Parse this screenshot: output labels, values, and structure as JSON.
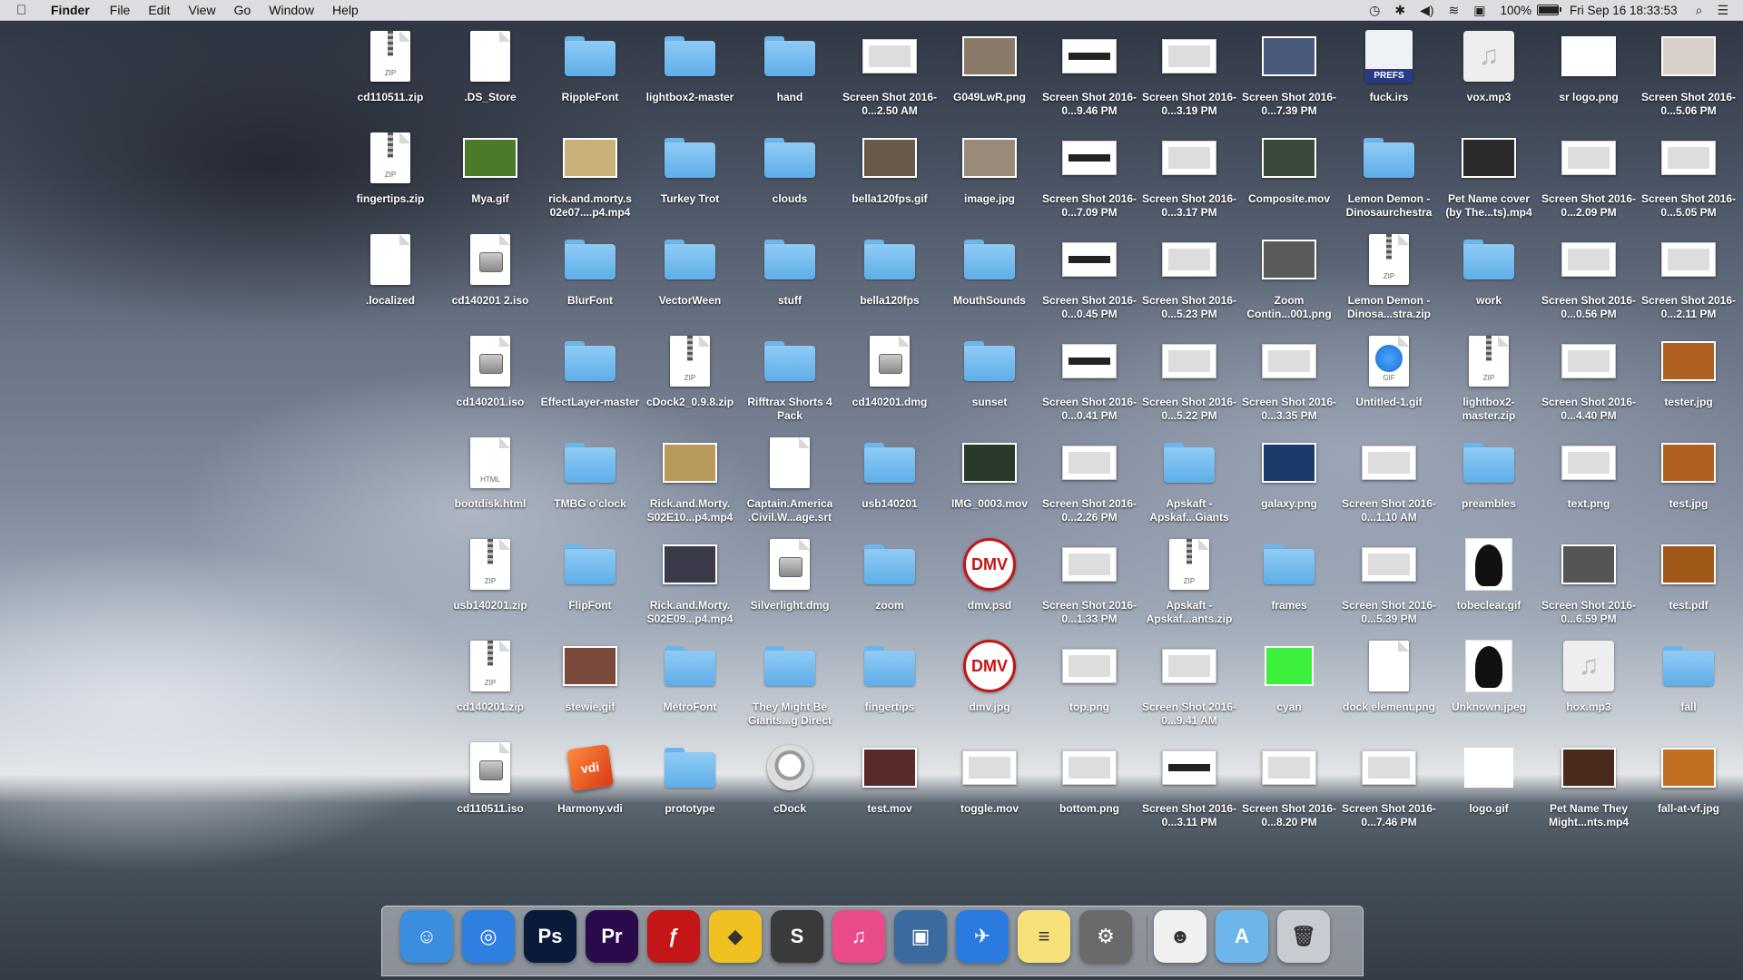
{
  "menubar": {
    "app": "Finder",
    "items": [
      "File",
      "Edit",
      "View",
      "Go",
      "Window",
      "Help"
    ],
    "battery_pct": "100%",
    "battery_level": 1.0,
    "clock": "Fri Sep 16  18:33:53"
  },
  "desktop": {
    "columns": [
      [
        {
          "label": "cd110511.zip",
          "kind": "zip",
          "tag": "ZIP"
        },
        {
          "label": "fingertips.zip",
          "kind": "zip",
          "tag": "ZIP"
        },
        {
          "label": ".localized",
          "kind": "doc",
          "tag": ""
        }
      ],
      [
        {
          "label": ".DS_Store",
          "kind": "doc",
          "tag": ""
        },
        {
          "label": "Mya.gif",
          "kind": "thumb",
          "color": "#4a7a2a"
        },
        {
          "label": "cd140201 2.iso",
          "kind": "disk",
          "tag": ""
        },
        {
          "label": "cd140201.iso",
          "kind": "disk",
          "tag": ""
        },
        {
          "label": "bootdisk.html",
          "kind": "doc",
          "tag": "HTML"
        },
        {
          "label": "usb140201.zip",
          "kind": "zip",
          "tag": "ZIP"
        },
        {
          "label": "cd140201.zip",
          "kind": "zip",
          "tag": "ZIP"
        },
        {
          "label": "cd110511.iso",
          "kind": "disk",
          "tag": ""
        }
      ],
      [
        {
          "label": "RippleFont",
          "kind": "folder"
        },
        {
          "label": "rick.and.morty.s 02e07....p4.mp4",
          "kind": "thumb",
          "color": "#c9b27a"
        },
        {
          "label": "BlurFont",
          "kind": "folder"
        },
        {
          "label": "EffectLayer-master",
          "kind": "folder"
        },
        {
          "label": "TMBG o'clock",
          "kind": "folder"
        },
        {
          "label": "FlipFont",
          "kind": "folder"
        },
        {
          "label": "stewie.gif",
          "kind": "thumb",
          "color": "#7a4a3a"
        },
        {
          "label": "Harmony.vdi",
          "kind": "vdi",
          "tag": "vdi"
        }
      ],
      [
        {
          "label": "lightbox2-master",
          "kind": "folder"
        },
        {
          "label": "Turkey Trot",
          "kind": "folder"
        },
        {
          "label": "VectorWeen",
          "kind": "folder"
        },
        {
          "label": "cDock2_0.9.8.zip",
          "kind": "zip",
          "tag": "ZIP"
        },
        {
          "label": "Rick.and.Morty. S02E10...p4.mp4",
          "kind": "thumb",
          "color": "#b89a5a"
        },
        {
          "label": "Rick.and.Morty. S02E09...p4.mp4",
          "kind": "thumb",
          "color": "#3a3a4a"
        },
        {
          "label": "MetroFont",
          "kind": "folder"
        },
        {
          "label": "prototype",
          "kind": "folder"
        }
      ],
      [
        {
          "label": "hand",
          "kind": "folder"
        },
        {
          "label": "clouds",
          "kind": "folder"
        },
        {
          "label": "stuff",
          "kind": "folder"
        },
        {
          "label": "Rifftrax Shorts 4 Pack",
          "kind": "folder"
        },
        {
          "label": "Captain.America .Civil.W...age.srt",
          "kind": "doc",
          "tag": ""
        },
        {
          "label": "Silverlight.dmg",
          "kind": "disk",
          "tag": ""
        },
        {
          "label": "They Might Be Giants...g Direct",
          "kind": "folder"
        },
        {
          "label": "cDock",
          "kind": "cdock"
        }
      ],
      [
        {
          "label": "Screen Shot 2016-0...2.50 AM",
          "kind": "shot-light"
        },
        {
          "label": "bella120fps.gif",
          "kind": "thumb",
          "color": "#6a5a4a"
        },
        {
          "label": "bella120fps",
          "kind": "folder"
        },
        {
          "label": "cd140201.dmg",
          "kind": "disk",
          "tag": ""
        },
        {
          "label": "usb140201",
          "kind": "folder"
        },
        {
          "label": "zoom",
          "kind": "folder"
        },
        {
          "label": "fingertips",
          "kind": "folder"
        },
        {
          "label": "test.mov",
          "kind": "thumb",
          "color": "#5a2a2a"
        }
      ],
      [
        {
          "label": "G049LwR.png",
          "kind": "thumb",
          "color": "#8a7a6a"
        },
        {
          "label": "image.jpg",
          "kind": "thumb",
          "color": "#9a8a7a"
        },
        {
          "label": "MouthSounds",
          "kind": "folder"
        },
        {
          "label": "sunset",
          "kind": "folder"
        },
        {
          "label": "IMG_0003.mov",
          "kind": "thumb",
          "color": "#2a3a2a"
        },
        {
          "label": "dmv.psd",
          "kind": "dmv",
          "tag": "DMV"
        },
        {
          "label": "dmv.jpg",
          "kind": "dmv",
          "tag": "DMV"
        },
        {
          "label": "toggle.mov",
          "kind": "shot-light"
        }
      ],
      [
        {
          "label": "Screen Shot 2016-0...9.46 PM",
          "kind": "shot"
        },
        {
          "label": "Screen Shot 2016-0...7.09 PM",
          "kind": "shot"
        },
        {
          "label": "Screen Shot 2016-0...0.45 PM",
          "kind": "shot"
        },
        {
          "label": "Screen Shot 2016-0...0.41 PM",
          "kind": "shot"
        },
        {
          "label": "Screen Shot 2016-0...2.26 PM",
          "kind": "shot-light"
        },
        {
          "label": "Screen Shot 2016-0...1.33 PM",
          "kind": "shot-light"
        },
        {
          "label": "top.png",
          "kind": "shot-light"
        },
        {
          "label": "bottom.png",
          "kind": "shot-light"
        }
      ],
      [
        {
          "label": "Screen Shot 2016-0...3.19 PM",
          "kind": "shot-light"
        },
        {
          "label": "Screen Shot 2016-0...3.17 PM",
          "kind": "shot-light"
        },
        {
          "label": "Screen Shot 2016-0...5.23 PM",
          "kind": "shot-light"
        },
        {
          "label": "Screen Shot 2016-0...5.22 PM",
          "kind": "shot-light"
        },
        {
          "label": "Apskaft - Apskaf...Giants",
          "kind": "folder"
        },
        {
          "label": "Apskaft - Apskaf...ants.zip",
          "kind": "zip",
          "tag": "ZIP"
        },
        {
          "label": "Screen Shot 2016-0...9.41 AM",
          "kind": "shot-light"
        },
        {
          "label": "Screen Shot 2016-0...3.11 PM",
          "kind": "shot"
        }
      ],
      [
        {
          "label": "Screen Shot 2016-0...7.39 PM",
          "kind": "thumb",
          "color": "#4a5a7a"
        },
        {
          "label": "Composite.mov",
          "kind": "thumb",
          "color": "#3a4a3a"
        },
        {
          "label": "Zoom Contin...001.png",
          "kind": "thumb",
          "color": "#5a5a5a"
        },
        {
          "label": "Screen Shot 2016-0...3.35 PM",
          "kind": "shot-light"
        },
        {
          "label": "galaxy.png",
          "kind": "thumb",
          "color": "#1a3a6a"
        },
        {
          "label": "frames",
          "kind": "folder"
        },
        {
          "label": "cyan",
          "kind": "square",
          "color": "#3cf03c"
        },
        {
          "label": "Screen Shot 2016-0...8.20 PM",
          "kind": "shot-light"
        }
      ],
      [
        {
          "label": "fuck.irs",
          "kind": "prefs",
          "tag": "PREFS"
        },
        {
          "label": "Lemon Demon - Dinosaurchestra",
          "kind": "folder"
        },
        {
          "label": "Lemon Demon - Dinosa...stra.zip",
          "kind": "zip",
          "tag": "ZIP"
        },
        {
          "label": "Untitled-1.gif",
          "kind": "safari",
          "tag": "GIF"
        },
        {
          "label": "Screen Shot 2016-0...1.10 AM",
          "kind": "shot-light"
        },
        {
          "label": "Screen Shot 2016-0...5.39 PM",
          "kind": "shot-light"
        },
        {
          "label": "dock element.png",
          "kind": "doc",
          "tag": ""
        },
        {
          "label": "Screen Shot 2016-0...7.46 PM",
          "kind": "shot-light"
        }
      ],
      [
        {
          "label": "vox.mp3",
          "kind": "music"
        },
        {
          "label": "Pet Name cover (by The...ts).mp4",
          "kind": "thumb",
          "color": "#2a2a2a"
        },
        {
          "label": "work",
          "kind": "folder"
        },
        {
          "label": "lightbox2-master.zip",
          "kind": "zip",
          "tag": "ZIP"
        },
        {
          "label": "preambles",
          "kind": "folder"
        },
        {
          "label": "tobeclear.gif",
          "kind": "silhouette"
        },
        {
          "label": "Unknown.jpeg",
          "kind": "silhouette"
        },
        {
          "label": "logo.gif",
          "kind": "square",
          "color": "#ffffff"
        }
      ],
      [
        {
          "label": "sr logo.png",
          "kind": "thumb",
          "color": "#ffffff"
        },
        {
          "label": "Screen Shot 2016-0...2.09 PM",
          "kind": "shot-light"
        },
        {
          "label": "Screen Shot 2016-0...0.56 PM",
          "kind": "shot-light"
        },
        {
          "label": "Screen Shot 2016-0...4.40 PM",
          "kind": "shot-light"
        },
        {
          "label": "text.png",
          "kind": "shot-light"
        },
        {
          "label": "Screen Shot 2016-0...6.59 PM",
          "kind": "thumb",
          "color": "#555555"
        },
        {
          "label": "hox.mp3",
          "kind": "music"
        },
        {
          "label": "Pet Name They Might...nts.mp4",
          "kind": "thumb",
          "color": "#4a2a1a"
        }
      ],
      [
        {
          "label": "Screen Shot 2016-0...5.06 PM",
          "kind": "thumb",
          "color": "#d8d0c8"
        },
        {
          "label": "Screen Shot 2016-0...5.05 PM",
          "kind": "shot-light"
        },
        {
          "label": "Screen Shot 2016-0...2.11 PM",
          "kind": "shot-light"
        },
        {
          "label": "tester.jpg",
          "kind": "thumb",
          "color": "#b06020"
        },
        {
          "label": "test.jpg",
          "kind": "thumb",
          "color": "#b06020"
        },
        {
          "label": "test.pdf",
          "kind": "thumb",
          "color": "#a05818"
        },
        {
          "label": "fall",
          "kind": "folder"
        },
        {
          "label": "fall-at-vf.jpg",
          "kind": "thumb",
          "color": "#c07020"
        }
      ]
    ]
  },
  "dock": {
    "items": [
      {
        "name": "finder",
        "label": "☺",
        "bg": "#3b8de0"
      },
      {
        "name": "safari",
        "label": "◎",
        "bg": "#2f7fe0"
      },
      {
        "name": "photoshop",
        "label": "Ps",
        "bg": "#0a1a3a"
      },
      {
        "name": "premiere",
        "label": "Pr",
        "bg": "#2a0a4a"
      },
      {
        "name": "flash",
        "label": "ƒ",
        "bg": "#c41616"
      },
      {
        "name": "cyberduck",
        "label": "◆",
        "bg": "#f0c020"
      },
      {
        "name": "sublime-text",
        "label": "S",
        "bg": "#3a3a3a"
      },
      {
        "name": "itunes",
        "label": "♫",
        "bg": "#e84a8a"
      },
      {
        "name": "virtualbox",
        "label": "▣",
        "bg": "#3a6aa0"
      },
      {
        "name": "mail-bird",
        "label": "✈",
        "bg": "#2a7ae0"
      },
      {
        "name": "notes",
        "label": "≡",
        "bg": "#f7e27a"
      },
      {
        "name": "system-preferences",
        "label": "⚙",
        "bg": "#6a6a6a"
      },
      {
        "name": "avatar-app",
        "label": "☻",
        "bg": "#f0f0f0"
      },
      {
        "name": "applications-folder",
        "label": "A",
        "bg": "#6cb6ec"
      },
      {
        "name": "trash",
        "label": "🗑",
        "bg": "#c8ccd2"
      }
    ]
  }
}
